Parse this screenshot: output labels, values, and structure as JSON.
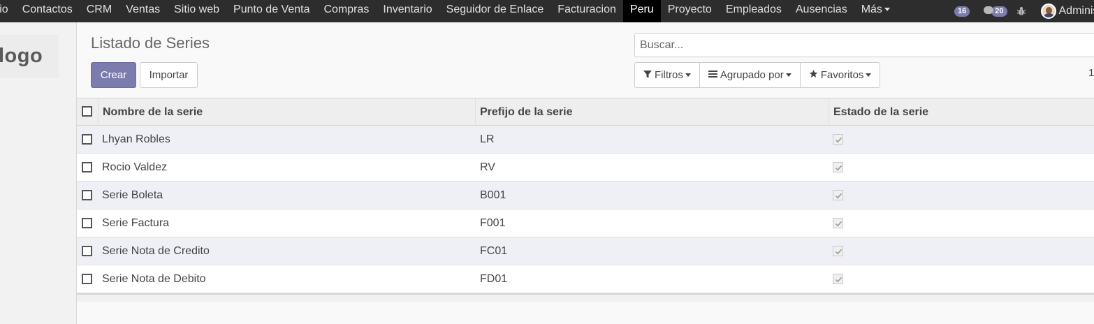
{
  "topbar": {
    "menu": [
      "ario",
      "Contactos",
      "CRM",
      "Ventas",
      "Sitio web",
      "Punto de Venta",
      "Compras",
      "Inventario",
      "Seguidor de Enlace",
      "Facturacion",
      "Peru",
      "Proyecto",
      "Empleados",
      "Ausencias"
    ],
    "active_item": "Peru",
    "more_label": "Más",
    "activity_count": "16",
    "message_count": "20",
    "user_name": "Administ"
  },
  "sidebar": {
    "logo_text": "logo"
  },
  "control_panel": {
    "title": "Listado de Series",
    "create_label": "Crear",
    "import_label": "Importar",
    "search_placeholder": "Buscar...",
    "filters_label": "Filtros",
    "groupby_label": "Agrupado por",
    "favorites_label": "Favoritos",
    "pager_text": "1"
  },
  "table": {
    "columns": [
      "Nombre de la serie",
      "Prefijo de la serie",
      "Estado de la serie"
    ],
    "rows": [
      {
        "name": "Lhyan Robles",
        "prefix": "LR",
        "state": true
      },
      {
        "name": "Rocio Valdez",
        "prefix": "RV",
        "state": true
      },
      {
        "name": "Serie Boleta",
        "prefix": "B001",
        "state": true
      },
      {
        "name": "Serie Factura",
        "prefix": "F001",
        "state": true
      },
      {
        "name": "Serie Nota de Credito",
        "prefix": "FC01",
        "state": true
      },
      {
        "name": "Serie Nota de Debito",
        "prefix": "FD01",
        "state": true
      }
    ]
  },
  "colors": {
    "topbar_bg": "#2d2d2d",
    "primary": "#7c7bad",
    "row_stripe": "#efeff6"
  }
}
